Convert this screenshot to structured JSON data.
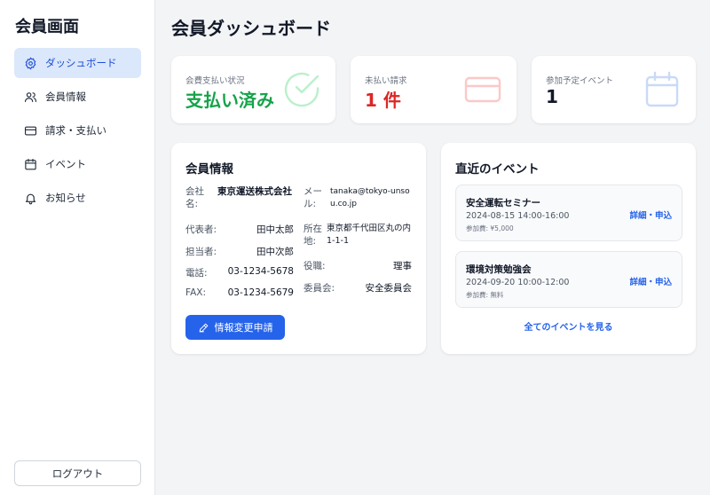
{
  "sidebar": {
    "brand": "会員画面",
    "items": [
      {
        "label": "ダッシュボード",
        "icon": "gear-icon",
        "active": true
      },
      {
        "label": "会員情報",
        "icon": "users-icon"
      },
      {
        "label": "請求・支払い",
        "icon": "credit-card-icon"
      },
      {
        "label": "イベント",
        "icon": "calendar-icon"
      },
      {
        "label": "お知らせ",
        "icon": "bell-icon"
      }
    ],
    "logout_label": "ログアウト"
  },
  "header": {
    "title": "会員ダッシュボード"
  },
  "stats": [
    {
      "label": "会費支払い状況",
      "value": "支払い済み",
      "color": "#16a34a",
      "icon": "check-circle-icon"
    },
    {
      "label": "未払い請求",
      "value": "1 件",
      "color": "#dc2626",
      "icon": "credit-card-icon"
    },
    {
      "label": "参加予定イベント",
      "value": "1",
      "color": "#111827",
      "icon": "calendar-icon"
    }
  ],
  "member_info": {
    "title": "会員情報",
    "left": [
      {
        "key": "会社名:",
        "value": "東京運送株式会社"
      },
      {
        "key": "代表者:",
        "value": "田中太郎"
      },
      {
        "key": "担当者:",
        "value": "田中次郎"
      },
      {
        "key": "電話:",
        "value": "03-1234-5678"
      },
      {
        "key": "FAX:",
        "value": "03-1234-5679"
      }
    ],
    "right": [
      {
        "key": "メール:",
        "value": "tanaka@tokyo-unsou.co.jp"
      },
      {
        "key": "所在地:",
        "value": "東京都千代田区丸の内1-1-1"
      },
      {
        "key": "役職:",
        "value": "理事"
      },
      {
        "key": "委員会:",
        "value": "安全委員会"
      }
    ],
    "edit_label": "情報変更申請"
  },
  "events": {
    "title": "直近のイベント",
    "items": [
      {
        "title": "安全運転セミナー",
        "datetime": "2024-08-15 14:00-16:00",
        "fee": "参加費: ¥5,000",
        "link": "詳細・申込"
      },
      {
        "title": "環境対策勉強会",
        "datetime": "2024-09-20 10:00-12:00",
        "fee": "参加費: 無料",
        "link": "詳細・申込"
      }
    ],
    "all_label": "全てのイベントを見る"
  },
  "colors": {
    "accent": "#2563eb",
    "active_bg": "#dbe7fb",
    "success": "#16a34a",
    "danger": "#dc2626"
  }
}
